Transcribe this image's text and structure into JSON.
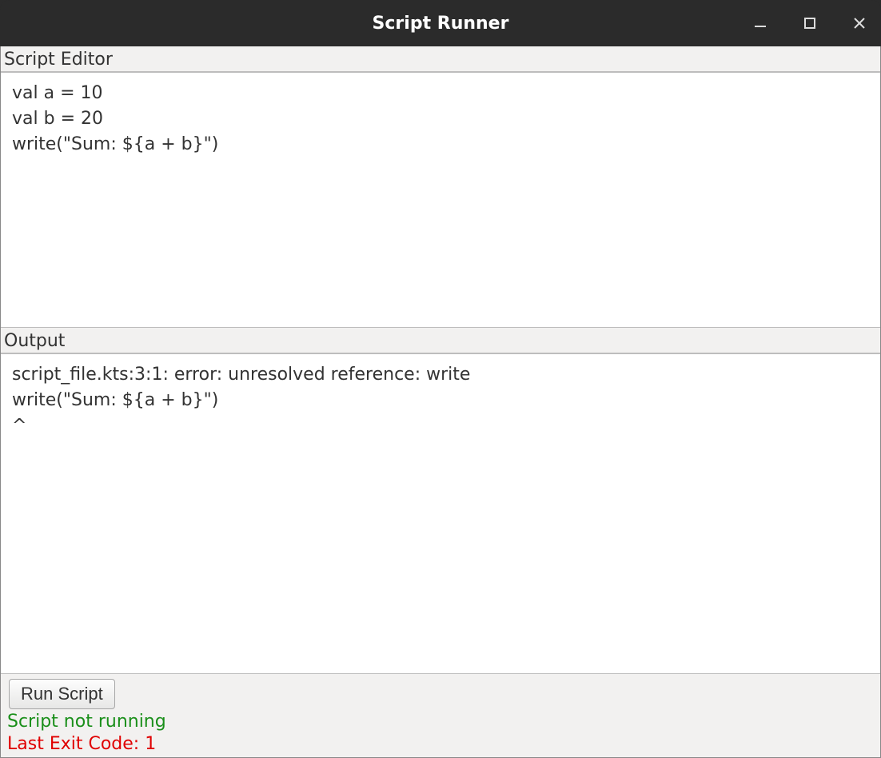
{
  "window": {
    "title": "Script Runner"
  },
  "editor": {
    "label": "Script Editor",
    "content": "val a = 10\nval b = 20\nwrite(\"Sum: ${a + b}\")"
  },
  "output": {
    "label": "Output",
    "content": "script_file.kts:3:1: error: unresolved reference: write\nwrite(\"Sum: ${a + b}\")\n^"
  },
  "controls": {
    "run_label": "Run Script"
  },
  "status": {
    "running_text": "Script not running",
    "exit_code_text": "Last Exit Code: 1"
  }
}
